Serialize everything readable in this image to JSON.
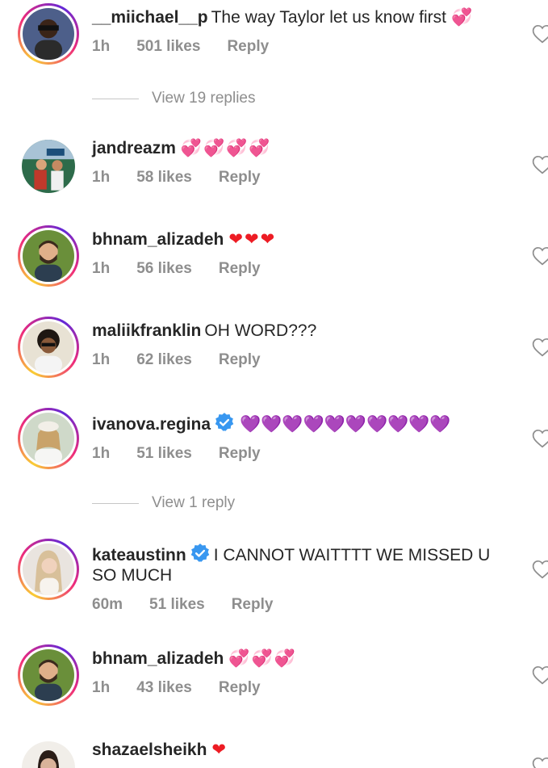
{
  "comments": [
    {
      "username": "__miichael__p",
      "text": "The way Taylor let us know first",
      "emoji": "💞",
      "time": "1h",
      "likes": "501 likes",
      "reply": "Reply",
      "verified": false
    },
    {
      "username": "jandreazm",
      "text": "",
      "emoji": "💞💞💞💞",
      "time": "1h",
      "likes": "58 likes",
      "reply": "Reply",
      "verified": false
    },
    {
      "username": "bhnam_alizadeh",
      "text": "",
      "emoji": "❤❤❤",
      "time": "1h",
      "likes": "56 likes",
      "reply": "Reply",
      "verified": false
    },
    {
      "username": "maliikfranklin",
      "text": "OH WORD???",
      "emoji": "",
      "time": "1h",
      "likes": "62 likes",
      "reply": "Reply",
      "verified": false
    },
    {
      "username": "ivanova.regina",
      "text": "",
      "emoji": "💜💜💜💜💜💜💜💜💜💜",
      "time": "1h",
      "likes": "51 likes",
      "reply": "Reply",
      "verified": true
    },
    {
      "username": "kateaustinn",
      "text": "I CANNOT WAITTTT WE MISSED U SO MUCH",
      "emoji": "",
      "time": "60m",
      "likes": "51 likes",
      "reply": "Reply",
      "verified": true
    },
    {
      "username": "bhnam_alizadeh",
      "text": "",
      "emoji": "💞💞💞",
      "time": "1h",
      "likes": "43 likes",
      "reply": "Reply",
      "verified": false
    },
    {
      "username": "shazaelsheikh",
      "text": "",
      "emoji": "❤",
      "verified": false
    }
  ],
  "view_replies": [
    {
      "label": "View 19 replies"
    },
    {
      "label": "View 1 reply"
    }
  ],
  "icons": {
    "like": "heart-outline-icon",
    "verified": "verified-badge-icon"
  },
  "colors": {
    "username": "#262626",
    "meta": "#8e8e8e",
    "verified": "#3897f0",
    "heart_red": "#ed1c24",
    "heart_purple": "#8c149e",
    "heart_pink": "#c93bd8"
  }
}
